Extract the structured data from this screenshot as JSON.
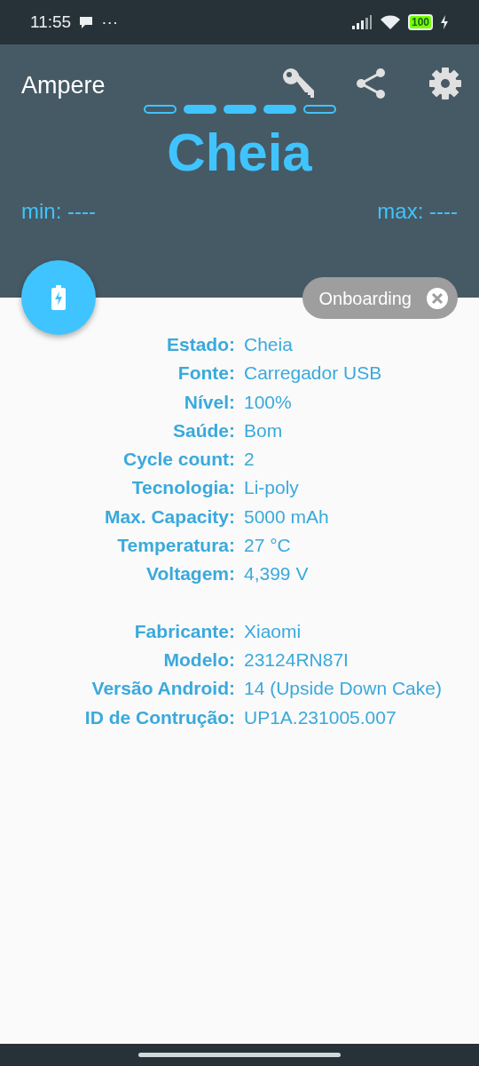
{
  "status_bar": {
    "time": "11:55",
    "overflow": "···",
    "battery": "100"
  },
  "app_bar": {
    "title": "Ampere"
  },
  "level_segments": [
    {
      "on": false
    },
    {
      "on": true
    },
    {
      "on": true
    },
    {
      "on": true
    },
    {
      "on": false
    }
  ],
  "state": "Cheia",
  "min": "min: ----",
  "max": "max: ----",
  "chip": {
    "label": "Onboarding"
  },
  "groups": [
    [
      {
        "label": "Estado:",
        "value": "Cheia"
      },
      {
        "label": "Fonte:",
        "value": "Carregador USB"
      },
      {
        "label": "Nível:",
        "value": "100%"
      },
      {
        "label": "Saúde:",
        "value": "Bom"
      },
      {
        "label": "Cycle count:",
        "value": "2"
      },
      {
        "label": "Tecnologia:",
        "value": "Li-poly"
      },
      {
        "label": "Max. Capacity:",
        "value": "5000 mAh"
      },
      {
        "label": "Temperatura:",
        "value": "27 °C"
      },
      {
        "label": "Voltagem:",
        "value": "4,399 V"
      }
    ],
    [
      {
        "label": "Fabricante:",
        "value": "Xiaomi"
      },
      {
        "label": "Modelo:",
        "value": "23124RN87I"
      },
      {
        "label": "Versão Android:",
        "value": "14 (Upside Down Cake)"
      },
      {
        "label": "ID de Contrução:",
        "value": "UP1A.231005.007"
      }
    ]
  ]
}
